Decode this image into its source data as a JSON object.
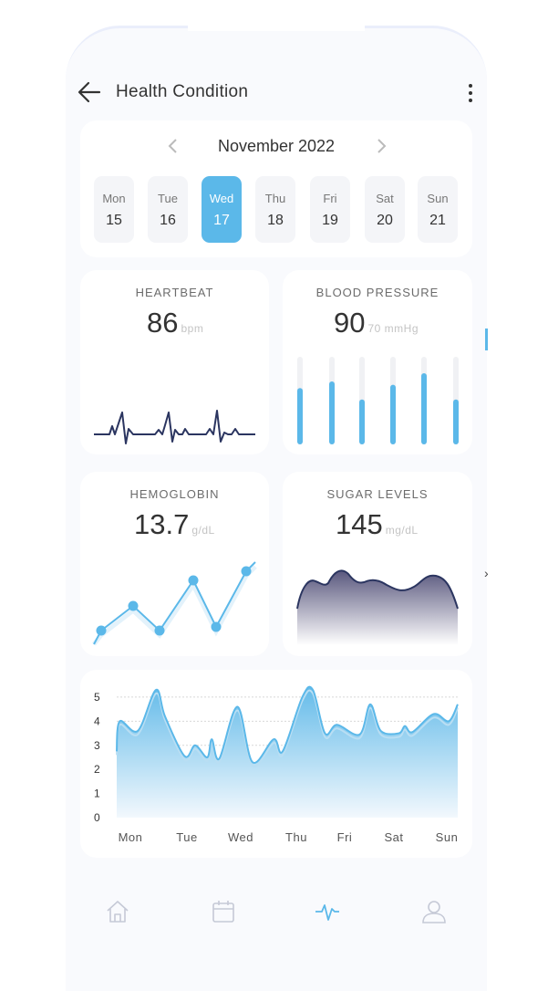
{
  "header": {
    "title": "Health Condition"
  },
  "calendar": {
    "month_label": "November 2022",
    "days": [
      {
        "name": "Mon",
        "date": "15"
      },
      {
        "name": "Tue",
        "date": "16"
      },
      {
        "name": "Wed",
        "date": "17"
      },
      {
        "name": "Thu",
        "date": "18"
      },
      {
        "name": "Fri",
        "date": "19"
      },
      {
        "name": "Sat",
        "date": "20"
      },
      {
        "name": "Sun",
        "date": "21"
      }
    ],
    "selected_day": "Wed"
  },
  "metrics": {
    "heartbeat": {
      "title": "HEARTBEAT",
      "value": "86",
      "unit": "bpm"
    },
    "blood_pressure": {
      "title": "BLOOD PRESSURE",
      "value": "90",
      "unit": "70 mmHg",
      "bar_levels": [
        0.62,
        0.7,
        0.48,
        0.66,
        0.8,
        0.48
      ]
    },
    "hemoglobin": {
      "title": "HEMOGLOBIN",
      "value": "13.7",
      "unit": "g/dL"
    },
    "sugar": {
      "title": "SUGAR LEVELS",
      "value": "145",
      "unit": "mg/dL"
    }
  },
  "chart_data": {
    "type": "area",
    "categories": [
      "Mon",
      "Tue",
      "Wed",
      "Thu",
      "Fri",
      "Sat",
      "Sun"
    ],
    "yticks": [
      "5",
      "4",
      "3",
      "2",
      "1",
      "0"
    ],
    "ylim": [
      0,
      5.3
    ],
    "x": [
      0,
      0.1,
      0.7,
      1.3,
      1.6,
      2.25,
      2.6,
      3,
      3.15,
      3.4,
      4,
      4.5,
      5.2,
      5.5,
      6.15,
      6.5,
      6.9,
      7.3,
      8.05,
      8.4,
      8.75,
      9.35,
      9.55,
      9.8,
      10.5,
      11,
      11.3
    ],
    "values": [
      2.75,
      4,
      3.6,
      5.3,
      4.2,
      2.55,
      3,
      2.5,
      3.25,
      2.45,
      4.6,
      2.3,
      3.25,
      2.75,
      5.0,
      5.3,
      3.5,
      3.85,
      3.45,
      4.7,
      3.6,
      3.5,
      3.8,
      3.55,
      4.3,
      4.0,
      4.7
    ],
    "xlim": [
      0,
      11.3
    ],
    "colors": {
      "line": "#5bb8e9",
      "fill_top": "#64bbe9",
      "fill_bottom": "#f2f8fd"
    }
  },
  "colors": {
    "accent": "#5bb8e9",
    "navy": "#2b3560",
    "sugar_fill": "#5a587e"
  },
  "bottom_nav": [
    {
      "name": "home-icon"
    },
    {
      "name": "calendar-icon"
    },
    {
      "name": "activity-icon"
    },
    {
      "name": "profile-icon"
    }
  ]
}
